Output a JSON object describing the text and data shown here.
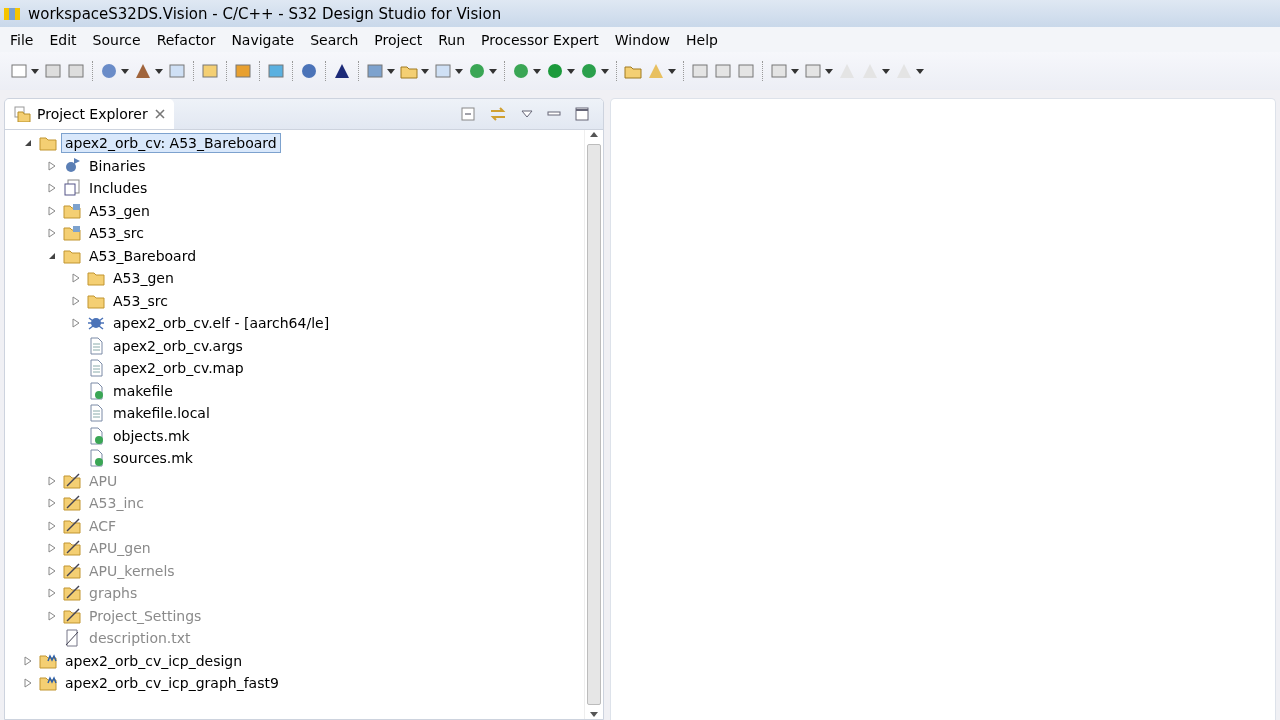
{
  "window": {
    "title": "workspaceS32DS.Vision - C/C++ - S32 Design Studio for Vision"
  },
  "menu": [
    "File",
    "Edit",
    "Source",
    "Refactor",
    "Navigate",
    "Search",
    "Project",
    "Run",
    "Processor Expert",
    "Window",
    "Help"
  ],
  "panel": {
    "title": "Project Explorer"
  },
  "tree": [
    {
      "label": "apex2_orb_cv: A53_Bareboard",
      "kind": "project",
      "expanded": true,
      "selected": true,
      "dimmed": false,
      "children": [
        {
          "label": "Binaries",
          "kind": "binaries",
          "expanded": false,
          "selected": false,
          "dimmed": false
        },
        {
          "label": "Includes",
          "kind": "includes",
          "expanded": false,
          "selected": false,
          "dimmed": false
        },
        {
          "label": "A53_gen",
          "kind": "source-folder",
          "expanded": false,
          "selected": false,
          "dimmed": false
        },
        {
          "label": "A53_src",
          "kind": "source-folder",
          "expanded": false,
          "selected": false,
          "dimmed": false
        },
        {
          "label": "A53_Bareboard",
          "kind": "folder",
          "expanded": true,
          "selected": false,
          "dimmed": false,
          "children": [
            {
              "label": "A53_gen",
              "kind": "folder",
              "expanded": false,
              "selected": false,
              "dimmed": false
            },
            {
              "label": "A53_src",
              "kind": "folder",
              "expanded": false,
              "selected": false,
              "dimmed": false
            },
            {
              "label": "apex2_orb_cv.elf - [aarch64/le]",
              "kind": "elf",
              "expanded": false,
              "selected": false,
              "dimmed": false
            },
            {
              "label": "apex2_orb_cv.args",
              "kind": "file",
              "selected": false,
              "dimmed": false
            },
            {
              "label": "apex2_orb_cv.map",
              "kind": "file",
              "selected": false,
              "dimmed": false
            },
            {
              "label": "makefile",
              "kind": "makefile",
              "selected": false,
              "dimmed": false
            },
            {
              "label": "makefile.local",
              "kind": "file",
              "selected": false,
              "dimmed": false
            },
            {
              "label": "objects.mk",
              "kind": "makefile",
              "selected": false,
              "dimmed": false
            },
            {
              "label": "sources.mk",
              "kind": "makefile",
              "selected": false,
              "dimmed": false
            }
          ]
        },
        {
          "label": "APU",
          "kind": "excluded-folder",
          "expanded": false,
          "selected": false,
          "dimmed": true
        },
        {
          "label": "A53_inc",
          "kind": "excluded-folder",
          "expanded": false,
          "selected": false,
          "dimmed": true
        },
        {
          "label": "ACF",
          "kind": "excluded-folder",
          "expanded": false,
          "selected": false,
          "dimmed": true
        },
        {
          "label": "APU_gen",
          "kind": "excluded-folder",
          "expanded": false,
          "selected": false,
          "dimmed": true
        },
        {
          "label": "APU_kernels",
          "kind": "excluded-folder",
          "expanded": false,
          "selected": false,
          "dimmed": true
        },
        {
          "label": "graphs",
          "kind": "excluded-folder",
          "expanded": false,
          "selected": false,
          "dimmed": true
        },
        {
          "label": "Project_Settings",
          "kind": "excluded-folder",
          "expanded": false,
          "selected": false,
          "dimmed": true
        },
        {
          "label": "description.txt",
          "kind": "text-file",
          "selected": false,
          "dimmed": true
        }
      ]
    },
    {
      "label": "apex2_orb_cv_icp_design",
      "kind": "m-project",
      "expanded": false,
      "selected": false,
      "dimmed": false
    },
    {
      "label": "apex2_orb_cv_icp_graph_fast9",
      "kind": "m-project",
      "expanded": false,
      "selected": false,
      "dimmed": false
    }
  ]
}
